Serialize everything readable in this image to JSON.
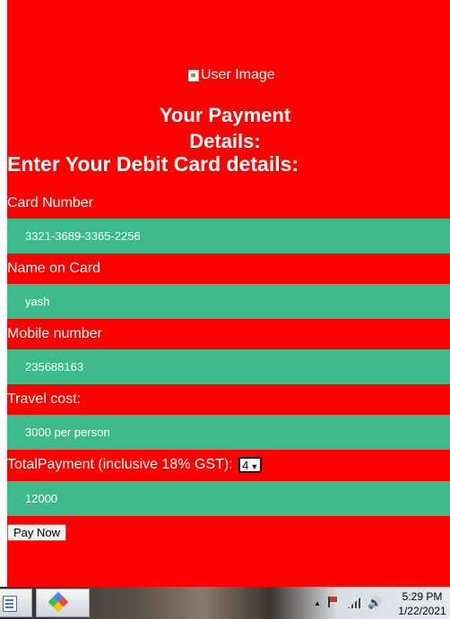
{
  "page": {
    "image_alt": "User Image",
    "title": "Your Payment Details:",
    "section_heading": "Enter Your Debit Card details:",
    "background_color": "#ff0000",
    "field_color": "#3dba8c"
  },
  "fields": {
    "card_number": {
      "label": "Card Number",
      "value": "3321-3689-3365-2256"
    },
    "name_on_card": {
      "label": "Name on Card",
      "value": "yash"
    },
    "mobile_number": {
      "label": "Mobile number",
      "value": "235688163"
    },
    "travel_cost": {
      "label": "Travel cost:",
      "value": "3000 per person"
    },
    "total_payment": {
      "label": "TotalPayment (inclusive 18% GST):",
      "selected_count": "4",
      "value": "12000"
    }
  },
  "actions": {
    "pay_now_label": "Pay Now"
  },
  "taskbar": {
    "time": "5:29 PM",
    "date": "1/22/2021",
    "icons": [
      "file-explorer-icon",
      "app-icon",
      "show-hidden-icons-arrow",
      "action-center-flag-icon",
      "network-signal-icon",
      "volume-icon"
    ]
  }
}
